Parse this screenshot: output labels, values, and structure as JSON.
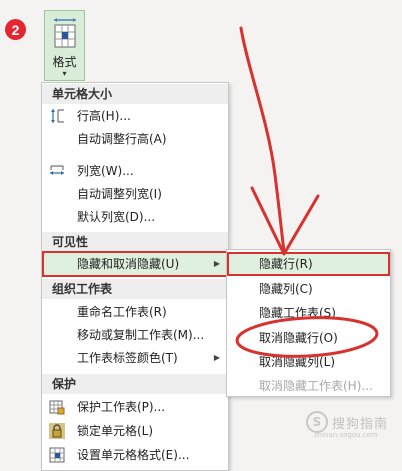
{
  "step_number": "2",
  "ribbon": {
    "format_button_label": "格式",
    "format_button_caret": "▾"
  },
  "menu": {
    "sections": [
      {
        "title": "单元格大小"
      },
      {
        "title": "可见性"
      },
      {
        "title": "组织工作表"
      },
      {
        "title": "保护"
      }
    ],
    "items": [
      {
        "label": "行高(H)...",
        "icon": "row-height-icon"
      },
      {
        "label": "自动调整行高(A)"
      },
      {
        "label": "列宽(W)...",
        "icon": "column-width-icon"
      },
      {
        "label": "自动调整列宽(I)"
      },
      {
        "label": "默认列宽(D)..."
      },
      {
        "label": "隐藏和取消隐藏(U)",
        "has_submenu": true,
        "highlighted": true
      },
      {
        "label": "重命名工作表(R)"
      },
      {
        "label": "移动或复制工作表(M)..."
      },
      {
        "label": "工作表标签颜色(T)",
        "has_submenu": true
      },
      {
        "label": "保护工作表(P)...",
        "icon": "protect-sheet-icon"
      },
      {
        "label": "锁定单元格(L)",
        "icon": "lock-icon"
      },
      {
        "label": "设置单元格格式(E)...",
        "icon": "format-cells-icon"
      }
    ],
    "submenu_arrow": "▶"
  },
  "submenu": {
    "items": [
      {
        "label": "隐藏行(R)",
        "highlighted": true
      },
      {
        "label": "隐藏列(C)"
      },
      {
        "label": "隐藏工作表(S)"
      },
      {
        "label": "取消隐藏行(O)",
        "circled": true
      },
      {
        "label": "取消隐藏列(L)"
      },
      {
        "label": "取消隐藏工作表(H)...",
        "disabled": true
      }
    ]
  },
  "watermark": {
    "text": "搜狗指南",
    "icon_letter": "S",
    "url": "zhinan.sogou.com"
  },
  "colors": {
    "highlight_bg": "#dff0de",
    "annotation_red": "#d8322f",
    "badge_red": "#e3262f"
  }
}
